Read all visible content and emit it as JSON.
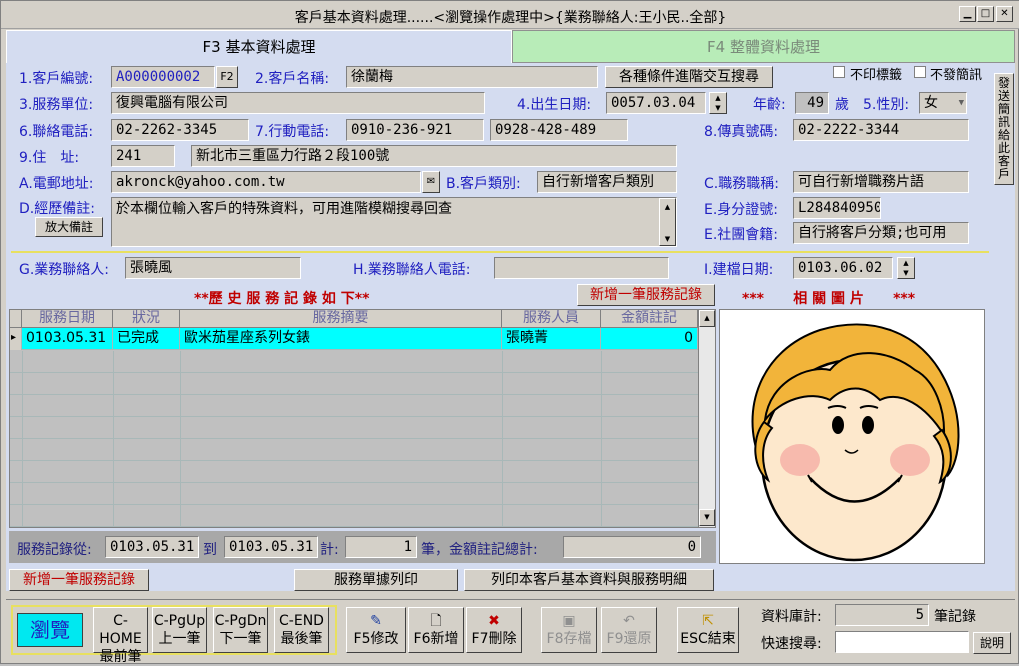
{
  "window": {
    "title": "客戶基本資料處理......<瀏覽操作處理中>{業務聯絡人:王小民..全部}",
    "min": "▁",
    "max": "□",
    "close": "✕"
  },
  "tabs": {
    "basic": "F3  基本資料處理",
    "all": "F4  整體資料處理"
  },
  "labels": {
    "cust_no": "1.客戶編號:",
    "cust_name": "2.客戶名稱:",
    "unit": "3.服務單位:",
    "birth": "4.出生日期:",
    "age": "年齡:",
    "age_unit": "歲",
    "sex": "5.性別:",
    "tel": "6.聯絡電話:",
    "mobile": "7.行動電話:",
    "fax": "8.傳真號碼:",
    "addr": "9.住　址:",
    "email": "A.電郵地址:",
    "cust_type": "B.客戶類別:",
    "title": "C.職務職稱:",
    "remark": "D.經歷備註:",
    "id": "E.身分證號:",
    "group": "E.社團會籍:",
    "sales": "G.業務聯絡人:",
    "sales_tel": "H.業務聯絡人電話:",
    "created": "I.建檔日期:"
  },
  "values": {
    "cust_no": "A000000002",
    "cust_name": "徐蘭梅",
    "unit": "復興電腦有限公司",
    "birth": "0057.03.04",
    "age": "49",
    "sex": "女",
    "tel": "02-2262-3345",
    "mobile1": "0910-236-921",
    "mobile2": "0928-428-489",
    "fax": "02-2222-3344",
    "zip": "241",
    "addr": "新北市三重區力行路２段100號",
    "email": "akronck@yahoo.com.tw",
    "cust_type": "自行新增客戶類別",
    "title": "可自行新增職務片語",
    "remark": "於本欄位輸入客戶的特殊資料，可用進階模糊搜尋回查",
    "id": "L284840950",
    "group": "自行將客戶分類;也可用",
    "sales": "張曉風",
    "sales_tel": "",
    "created": "0103.06.02"
  },
  "buttons": {
    "f2": "F2",
    "adv_search": "各種條件進階交互搜尋",
    "no_label": "不印標籤",
    "no_sms": "不發簡訊",
    "send_sms": "發送簡訊給此客戶",
    "enlarge": "放大備註",
    "add_record_top": "新增一筆服務記錄",
    "add_record": "新增一筆服務記錄",
    "print_slip": "服務單據列印",
    "print_detail": "列印本客戶基本資料與服務明細"
  },
  "history": {
    "title": "**歷 史 服 務 記 錄 如 下**",
    "columns": [
      "服務日期",
      "狀況",
      "服務摘要",
      "服務人員",
      "金額註記"
    ],
    "rows": [
      [
        "0103.05.31",
        "已完成",
        "歐米茄星座系列女錶",
        "張曉菁",
        "0"
      ]
    ],
    "marker": "▸"
  },
  "photo": {
    "title": "***      相 關 圖 片      ***"
  },
  "summary": {
    "from_label": "服務記錄從:",
    "from": "0103.05.31",
    "to_label": "到",
    "to": "0103.05.31",
    "count_label": "計:",
    "count": "1",
    "unit_label": "筆，金額註記總計:",
    "total": "0"
  },
  "nav": {
    "mode": "瀏覽",
    "home": [
      "C-HOME",
      "最前筆"
    ],
    "pgup": [
      "C-PgUp",
      "上一筆"
    ],
    "pgdn": [
      "C-PgDn",
      "下一筆"
    ],
    "end": [
      "C-END",
      "最後筆"
    ],
    "f5": "F5修改",
    "f6": "F6新增",
    "f7": "F7刪除",
    "f8": "F8存檔",
    "f9": "F9還原",
    "esc": "ESC結束"
  },
  "stats": {
    "count_label": "資料庫計:",
    "count": "5",
    "count_unit": "筆記錄",
    "search_label": "快速搜尋:",
    "search_value": "",
    "help": "說明"
  }
}
